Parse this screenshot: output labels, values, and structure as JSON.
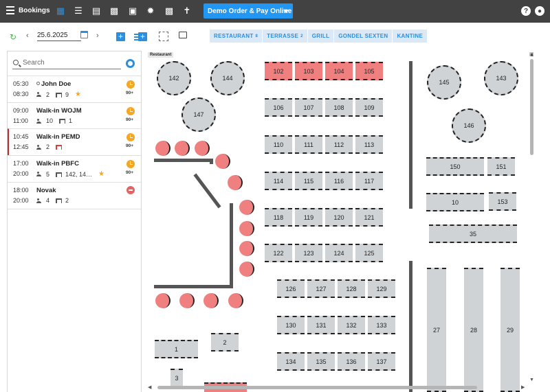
{
  "header": {
    "app_title": "Bookings",
    "venue": "Demo Order & Pay Online",
    "tool_icons": [
      "calendar-icon",
      "hierarchy-icon",
      "list-icon",
      "calendar-grid-icon",
      "qr-scan-icon",
      "settings-cogs-icon",
      "calendar-add-icon",
      "cutlery-icon"
    ],
    "help_label": "?"
  },
  "toolbar": {
    "date": "25.6.2025",
    "tabs": [
      {
        "label": "RESTAURANT",
        "count": "8"
      },
      {
        "label": "TERRASSE",
        "count": "2"
      },
      {
        "label": "GRILL",
        "count": ""
      },
      {
        "label": "GONDEL SEXTEN",
        "count": ""
      },
      {
        "label": "KANTINE",
        "count": ""
      }
    ]
  },
  "sidebar": {
    "search_placeholder": "Search",
    "bookings": [
      {
        "start": "05:30",
        "end": "08:30",
        "name": "John Doe",
        "guests": "2",
        "tables": "9",
        "star": true,
        "status": "waiting",
        "duration": "90+"
      },
      {
        "start": "09:00",
        "end": "11:00",
        "name": "Walk-in WOJM",
        "guests": "10",
        "tables": "1",
        "star": false,
        "status": "waiting",
        "duration": "90+"
      },
      {
        "start": "10:45",
        "end": "12:45",
        "name": "Walk-in PEMD",
        "guests": "2",
        "tables": "",
        "star": false,
        "status": "waiting",
        "duration": "90+"
      },
      {
        "start": "17:00",
        "end": "20:00",
        "name": "Walk-in PBFC",
        "guests": "5",
        "tables": "142, 14…",
        "star": true,
        "status": "waiting",
        "duration": "90+"
      },
      {
        "start": "18:00",
        "end": "20:00",
        "name": "Novak",
        "guests": "4",
        "tables": "2",
        "star": false,
        "status": "cancelled",
        "duration": ""
      }
    ]
  },
  "floor": {
    "area_label": "Restaurant",
    "tables": {
      "t142": "142",
      "t144": "144",
      "t147": "147",
      "t145": "145",
      "t143": "143",
      "t146": "146",
      "t102": "102",
      "t103": "103",
      "t104": "104",
      "t105": "105",
      "t106": "106",
      "t107": "107",
      "t108": "108",
      "t109": "109",
      "t110": "110",
      "t111": "111",
      "t112": "112",
      "t113": "113",
      "t114": "114",
      "t115": "115",
      "t116": "116",
      "t117": "117",
      "t118": "118",
      "t119": "119",
      "t120": "120",
      "t121": "121",
      "t122": "122",
      "t123": "123",
      "t124": "124",
      "t125": "125",
      "t126": "126",
      "t127": "127",
      "t128": "128",
      "t129": "129",
      "t130": "130",
      "t131": "131",
      "t132": "132",
      "t133": "133",
      "t134": "134",
      "t135": "135",
      "t136": "136",
      "t137": "137",
      "t150": "150",
      "t151": "151",
      "t10": "10",
      "t153": "153",
      "t35": "35",
      "t27": "27",
      "t28": "28",
      "t29": "29",
      "t1": "1",
      "t2": "2",
      "t3": "3"
    },
    "occupied": [
      "102",
      "103",
      "104",
      "105"
    ]
  }
}
